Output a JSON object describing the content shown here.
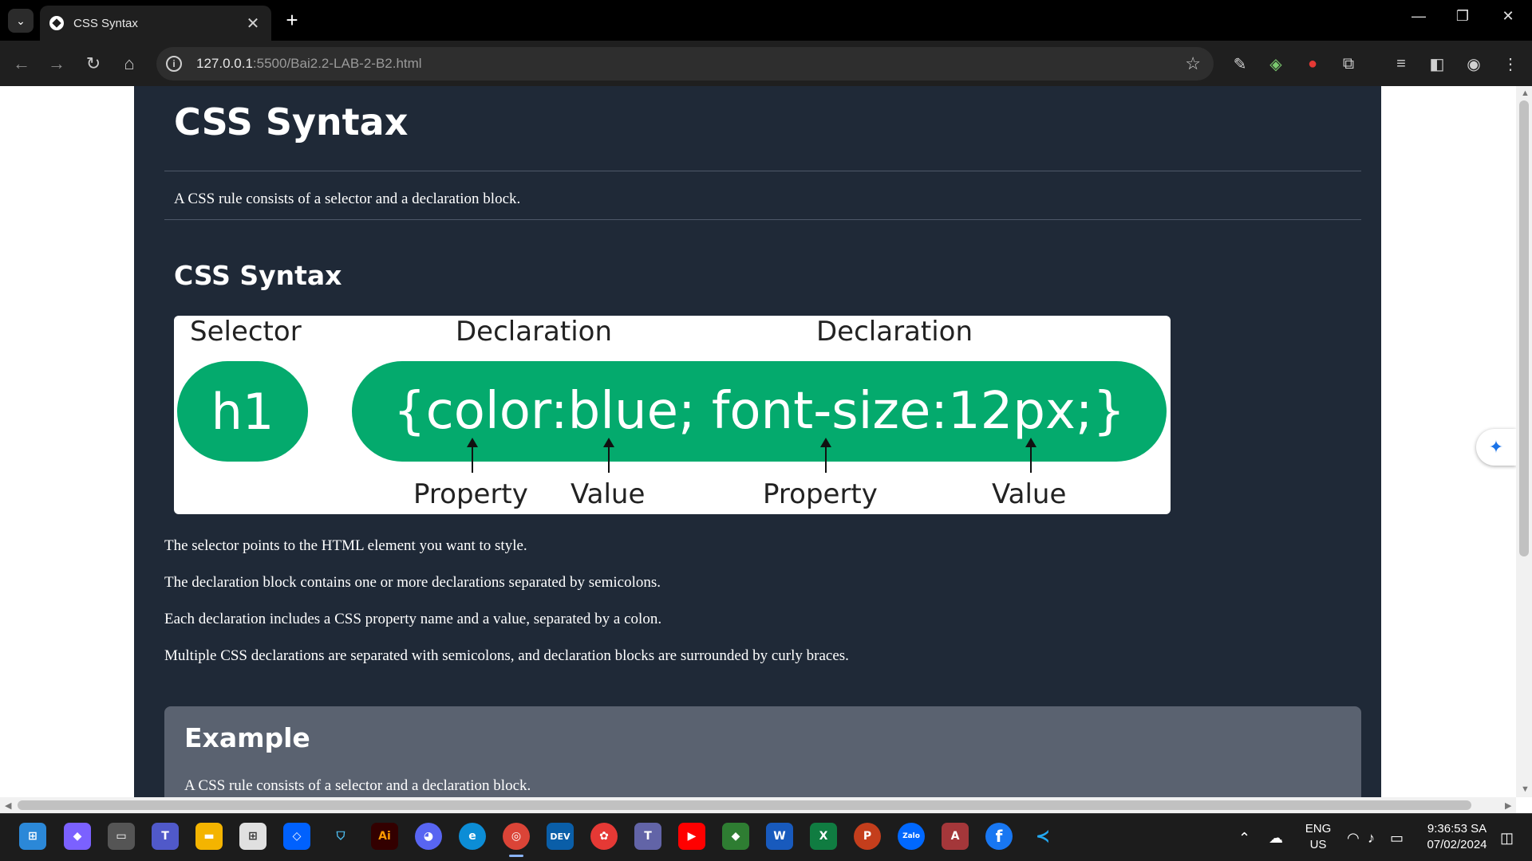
{
  "browser": {
    "tab_title": "CSS Syntax",
    "url_host": "127.0.0.1",
    "url_path": ":5500/Bai2.2-LAB-2-B2.html",
    "controls": {
      "minimize": "—",
      "restore": "❐",
      "close": "✕",
      "new_tab": "+",
      "tab_close": "✕",
      "tab_menu": "⌄"
    }
  },
  "page": {
    "title": "CSS Syntax",
    "intro": "A CSS rule consists of a selector and a declaration block.",
    "section_heading": "CSS Syntax",
    "diagram": {
      "label_selector": "Selector",
      "label_declaration_1": "Declaration",
      "label_declaration_2": "Declaration",
      "selector_code": "h1",
      "declaration_code": "{color:blue; font-size:12px;}",
      "label_property_1": "Property",
      "label_value_1": "Value",
      "label_property_2": "Property",
      "label_value_2": "Value"
    },
    "paragraphs": [
      "The selector points to the HTML element you want to style.",
      "The declaration block contains one or more declarations separated by semicolons.",
      "Each declaration includes a CSS property name and a value, separated by a colon.",
      "Multiple CSS declarations are separated with semicolons, and declaration blocks are surrounded by curly braces."
    ],
    "example": {
      "title": "Example",
      "text": "A CSS rule consists of a selector and a declaration block."
    }
  },
  "taskbar": {
    "language_line1": "ENG",
    "language_line2": "US",
    "time": "9:36:53 SA",
    "date": "07/02/2024",
    "apps": [
      "start",
      "copilot",
      "task-view",
      "teams",
      "file-explorer",
      "microsoft-store",
      "dropbox",
      "security",
      "illustrator",
      "discord",
      "edge",
      "chrome",
      "devtools",
      "photos",
      "teams-2",
      "youtube",
      "git",
      "word",
      "excel",
      "powerpoint",
      "zalo",
      "access",
      "facebook",
      "vscode"
    ],
    "app_labels": {
      "illustrator": "Ai",
      "devtools": "DEV",
      "word": "W",
      "excel": "X",
      "powerpoint": "P",
      "zalo": "Zalo",
      "access": "A",
      "facebook": "f"
    }
  },
  "colors": {
    "page_background": "#1f2937",
    "green_accent": "#04aa6d",
    "example_box": "#5a6270"
  }
}
